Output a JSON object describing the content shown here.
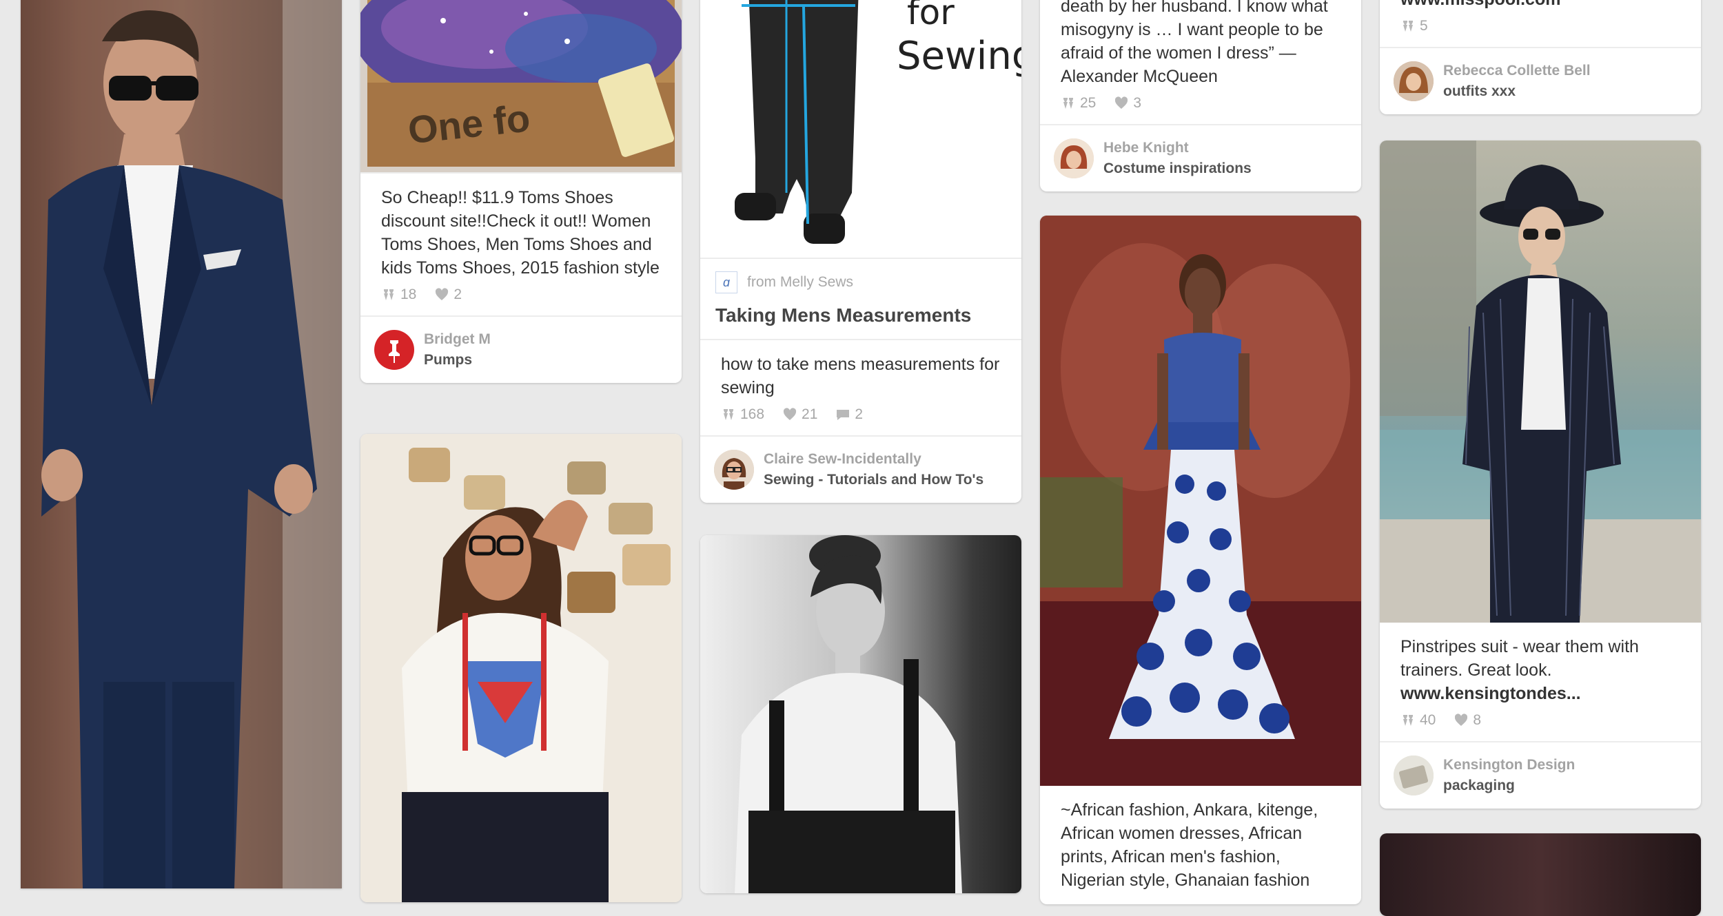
{
  "pins": [
    {
      "id": "suit",
      "image_alt": "Man in navy suit with sunglasses"
    },
    {
      "id": "toms",
      "description": "So Cheap!! $11.9 Toms Shoes discount site!!Check it out!! Women Toms Shoes, Men Toms Shoes and kids Toms Shoes, 2015 fashion style",
      "repins": "18",
      "likes": "2",
      "user": "Bridget M",
      "board": "Pumps",
      "box_text": "One fo"
    },
    {
      "id": "superman",
      "image_alt": "Woman in glasses with Superman shirt and suspenders"
    },
    {
      "id": "measurements",
      "image_text": "for Sewing",
      "source": "from Melly Sews",
      "title": "Taking Mens Measurements",
      "description": "how to take mens measurements for sewing",
      "repins": "168",
      "likes": "21",
      "comments": "2",
      "user": "Claire Sew-Incidentally",
      "board": "Sewing - Tutorials and How To's"
    },
    {
      "id": "bw",
      "image_alt": "Black and white portrait of woman with suspenders"
    },
    {
      "id": "mcqueen",
      "description": "death by her husband. I know what misogyny is … I want people to be afraid of the women I dress” — Alexander McQueen",
      "repins": "25",
      "likes": "3",
      "user": "Hebe Knight",
      "board": "Costume inspirations"
    },
    {
      "id": "african",
      "description": "~African fashion, Ankara, kitenge, African women dresses, African prints, African men's fashion, Nigerian style, Ghanaian fashion"
    },
    {
      "id": "misspool",
      "link": "www.misspool.com",
      "repins": "5",
      "user": "Rebecca Collette Bell",
      "board": "outfits xxx"
    },
    {
      "id": "pinstripe",
      "description": "Pinstripes suit - wear them with trainers. Great look.",
      "link": "www.kensingtondes...",
      "repins": "40",
      "likes": "8",
      "user": "Kensington Design",
      "board": "packaging"
    }
  ],
  "colors": {
    "background": "#e9e9e9",
    "pin_red": "#d52327",
    "text_muted": "#a7a7a7"
  }
}
